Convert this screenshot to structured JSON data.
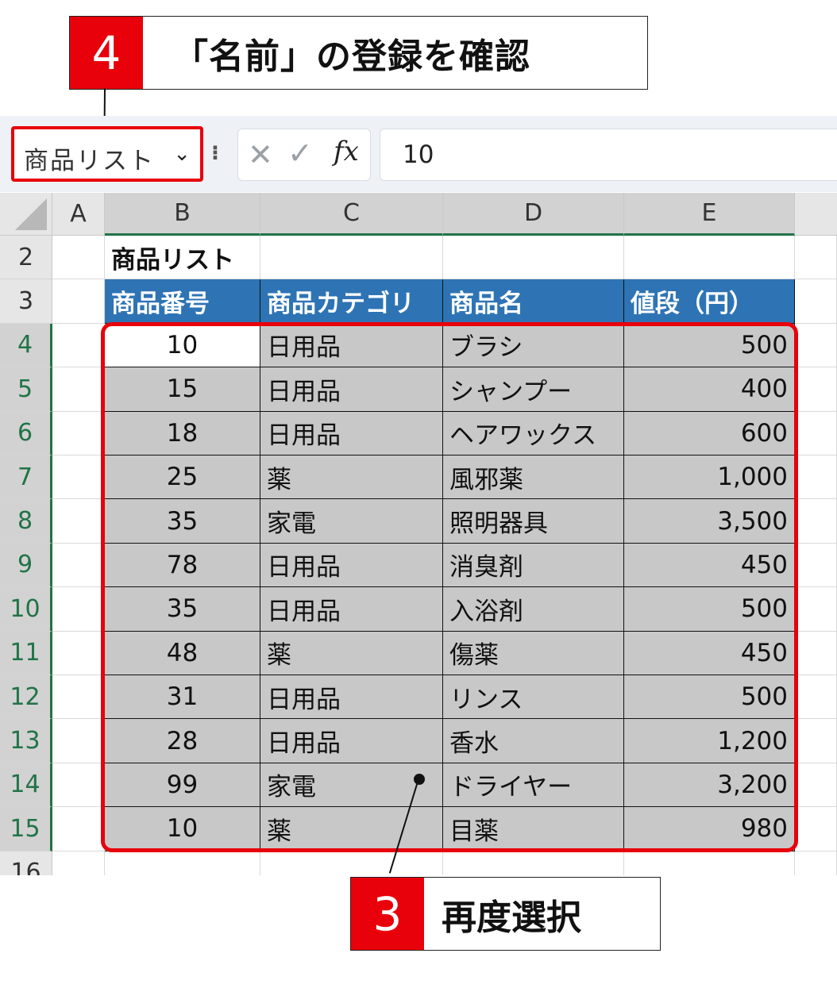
{
  "callouts": [
    {
      "number": "4",
      "text": "「名前」の登録を確認"
    },
    {
      "number": "3",
      "text": "再度選択"
    }
  ],
  "formula_bar": {
    "name_box_value": "商品リスト",
    "cancel_symbol": "✕",
    "enter_symbol": "✓",
    "fx_label": "fx",
    "formula_value": "10"
  },
  "columns": [
    "A",
    "B",
    "C",
    "D",
    "E"
  ],
  "selected_columns": [
    "B",
    "C",
    "D",
    "E"
  ],
  "rows": [
    "2",
    "3",
    "4",
    "5",
    "6",
    "7",
    "8",
    "9",
    "10",
    "11",
    "12",
    "13",
    "14",
    "15",
    "16"
  ],
  "selected_rows": [
    "4",
    "5",
    "6",
    "7",
    "8",
    "9",
    "10",
    "11",
    "12",
    "13",
    "14",
    "15"
  ],
  "sheet": {
    "title": "商品リスト",
    "headers": [
      "商品番号",
      "商品カテゴリ",
      "商品名",
      "値段（円）"
    ],
    "records": [
      [
        "10",
        "日用品",
        "ブラシ",
        "500"
      ],
      [
        "15",
        "日用品",
        "シャンプー",
        "400"
      ],
      [
        "18",
        "日用品",
        "ヘアワックス",
        "600"
      ],
      [
        "25",
        "薬",
        "風邪薬",
        "1,000"
      ],
      [
        "35",
        "家電",
        "照明器具",
        "3,500"
      ],
      [
        "78",
        "日用品",
        "消臭剤",
        "450"
      ],
      [
        "35",
        "日用品",
        "入浴剤",
        "500"
      ],
      [
        "48",
        "薬",
        "傷薬",
        "450"
      ],
      [
        "31",
        "日用品",
        "リンス",
        "500"
      ],
      [
        "28",
        "日用品",
        "香水",
        "1,200"
      ],
      [
        "99",
        "家電",
        "ドライヤー",
        "3,200"
      ],
      [
        "10",
        "薬",
        "目薬",
        "980"
      ]
    ]
  },
  "colors": {
    "accent_red": "#e8000b",
    "header_blue": "#2e74b5",
    "selection_gray": "#c8c8c8",
    "excel_green": "#217346"
  }
}
